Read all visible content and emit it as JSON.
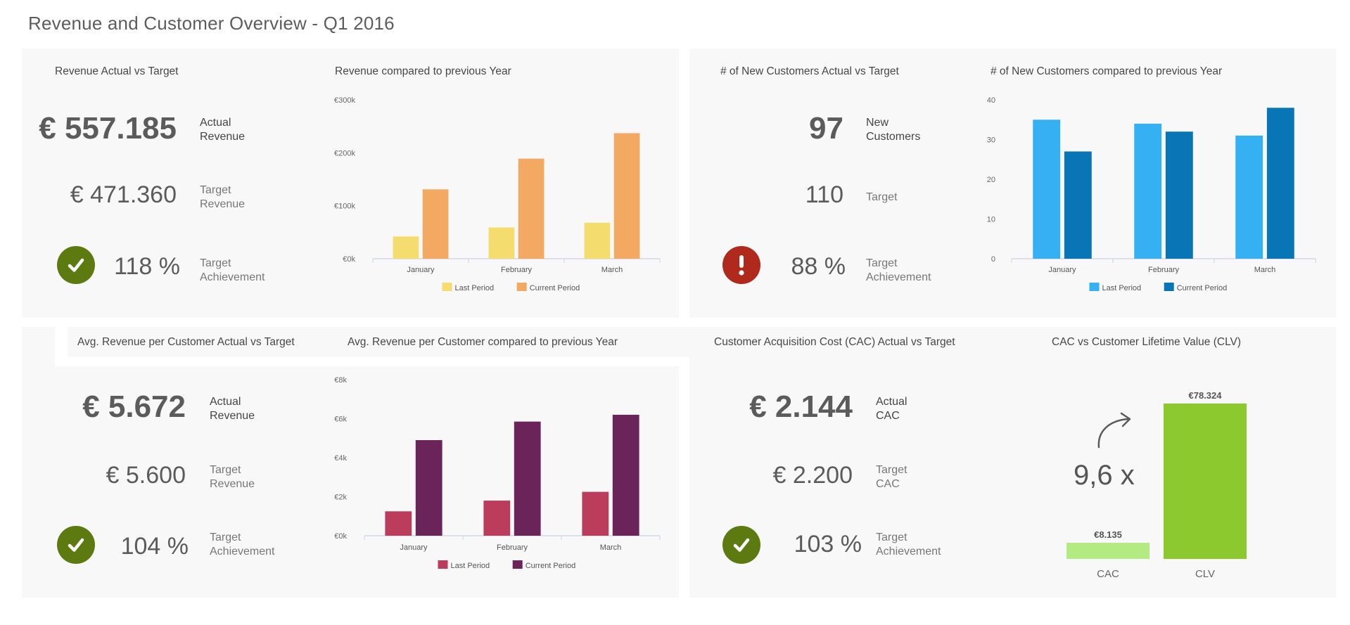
{
  "page": {
    "title": "Revenue and Customer Overview - Q1 2016"
  },
  "revenue_kpis": {
    "title": "Revenue Actual vs Target",
    "actual_value": "€ 557.185",
    "actual_label_1": "Actual",
    "actual_label_2": "Revenue",
    "target_value": "€ 471.360",
    "target_label_1": "Target",
    "target_label_2": "Revenue",
    "achievement_value": "118 %",
    "achievement_label_1": "Target",
    "achievement_label_2": "Achievement",
    "status": "ok"
  },
  "customers_kpis": {
    "title": "# of New Customers Actual vs Target",
    "actual_value": "97",
    "actual_label_1": "New",
    "actual_label_2": "Customers",
    "target_value": "110",
    "target_label_1": "Target",
    "achievement_value": "88 %",
    "achievement_label_1": "Target",
    "achievement_label_2": "Achievement",
    "status": "bad"
  },
  "arpc_kpis": {
    "title": "Avg. Revenue per Customer Actual vs Target",
    "actual_value": "€ 5.672",
    "actual_label_1": "Actual",
    "actual_label_2": "Revenue",
    "target_value": "€ 5.600",
    "target_label_1": "Target",
    "target_label_2": "Revenue",
    "achievement_value": "104 %",
    "achievement_label_1": "Target",
    "achievement_label_2": "Achievement",
    "status": "ok"
  },
  "cac_kpis": {
    "title": "Customer Acquisition Cost (CAC) Actual vs Target",
    "actual_value": "€ 2.144",
    "actual_label_1": "Actual",
    "actual_label_2": "CAC",
    "target_value": "€ 2.200",
    "target_label_1": "Target",
    "target_label_2": "CAC",
    "achievement_value": "103 %",
    "achievement_label_1": "Target",
    "achievement_label_2": "Achievement",
    "status": "ok"
  },
  "clv": {
    "title": "CAC vs Customer Lifetime Value (CLV)",
    "ratio": "9,6 x",
    "arrow_icon": "curved-arrow-icon"
  },
  "status_icons": {
    "ok": "checkmark-icon",
    "bad": "exclamation-icon"
  },
  "colors": {
    "panel_bg": "#f8f8f9",
    "ok": "#5c7a10",
    "bad": "#b0291d"
  },
  "chart_data": [
    {
      "id": "revenue_prev_year",
      "type": "bar",
      "title": "Revenue compared to previous Year",
      "categories": [
        "January",
        "February",
        "March"
      ],
      "series": [
        {
          "name": "Last Period",
          "color": "#f4dc6e",
          "values": [
            42000,
            59000,
            68000
          ]
        },
        {
          "name": "Current Period",
          "color": "#f4a962",
          "values": [
            131000,
            189000,
            237000
          ]
        }
      ],
      "ylim": [
        0,
        300000
      ],
      "yticks": [
        0,
        100000,
        200000,
        300000
      ],
      "ytick_labels": [
        "€0k",
        "€100k",
        "€200k",
        "€300k"
      ],
      "grid": false,
      "legend": "bottom"
    },
    {
      "id": "customers_prev_year",
      "type": "bar",
      "title": "# of New Customers compared to previous Year",
      "categories": [
        "January",
        "February",
        "March"
      ],
      "series": [
        {
          "name": "Last Period",
          "color": "#35b1f3",
          "values": [
            35,
            34,
            31
          ]
        },
        {
          "name": "Current Period",
          "color": "#0876b6",
          "values": [
            27,
            32,
            38
          ]
        }
      ],
      "ylim": [
        0,
        40
      ],
      "yticks": [
        0,
        10,
        20,
        30,
        40
      ],
      "ytick_labels": [
        "0",
        "10",
        "20",
        "30",
        "40"
      ],
      "grid": false,
      "legend": "bottom"
    },
    {
      "id": "arpc_prev_year",
      "type": "bar",
      "title": "Avg. Revenue per Customer compared to previous Year",
      "categories": [
        "January",
        "February",
        "March"
      ],
      "series": [
        {
          "name": "Last Period",
          "color": "#bc3d5b",
          "values": [
            1250,
            1800,
            2250
          ]
        },
        {
          "name": "Current Period",
          "color": "#6a2459",
          "values": [
            4900,
            5850,
            6200
          ]
        }
      ],
      "ylim": [
        0,
        8000
      ],
      "yticks": [
        0,
        2000,
        4000,
        6000,
        8000
      ],
      "ytick_labels": [
        "€0k",
        "€2k",
        "€4k",
        "€6k",
        "€8k"
      ],
      "grid": false,
      "legend": "bottom"
    },
    {
      "id": "cac_vs_clv",
      "type": "bar",
      "title": "CAC vs Customer Lifetime Value (CLV)",
      "categories": [
        "CAC",
        "CLV"
      ],
      "values": [
        8135,
        78324
      ],
      "value_labels": [
        "€8.135",
        "€78.324"
      ],
      "colors": [
        "#b3ea82",
        "#8bc92f"
      ],
      "ylim": [
        0,
        78324
      ]
    }
  ]
}
